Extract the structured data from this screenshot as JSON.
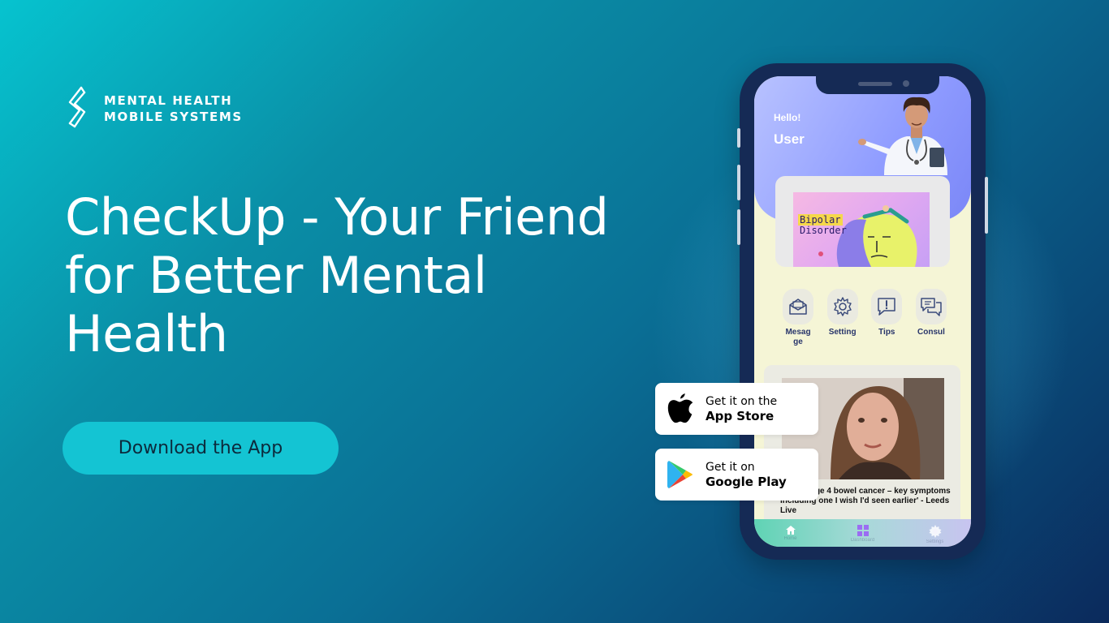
{
  "brand": {
    "line1": "MENTAL HEALTH",
    "line2": "MOBILE SYSTEMS",
    "logo_icon": "lightning-s-logo"
  },
  "hero": {
    "headline_line1": "CheckUp - Your Friend",
    "headline_line2": "for Better Mental",
    "headline_line3": "Health",
    "cta_label": "Download the App"
  },
  "colors": {
    "bg_start": "#06c3cf",
    "bg_end": "#0b2a5c",
    "cta_bg": "#14c4d3",
    "phone_body": "#152a55",
    "app_header": "#8f9cff"
  },
  "app": {
    "greeting": "Hello!",
    "username": "User",
    "banner_title_line1": "Bipolar",
    "banner_title_line2": "Disorder",
    "menu": [
      {
        "label": "Mesag ge",
        "icon": "envelope-icon"
      },
      {
        "label": "Setting",
        "icon": "gear-icon"
      },
      {
        "label": "Tips",
        "icon": "exclamation-chat-icon"
      },
      {
        "label": "Consul",
        "icon": "chat-bubbles-icon"
      }
    ],
    "video_caption": "'I had stage 4 bowel cancer – key symptoms including one I wish I'd seen earlier' - Leeds Live",
    "bottom_nav": [
      {
        "icon": "home-icon",
        "label": "Home"
      },
      {
        "icon": "dashboard-icon",
        "label": "Dashboard"
      },
      {
        "icon": "settings-icon",
        "label": "Settings"
      }
    ]
  },
  "stores": {
    "appstore_line1": "Get it on the",
    "appstore_line2": "App Store",
    "google_line1": "Get it on",
    "google_line2": "Google Play"
  }
}
